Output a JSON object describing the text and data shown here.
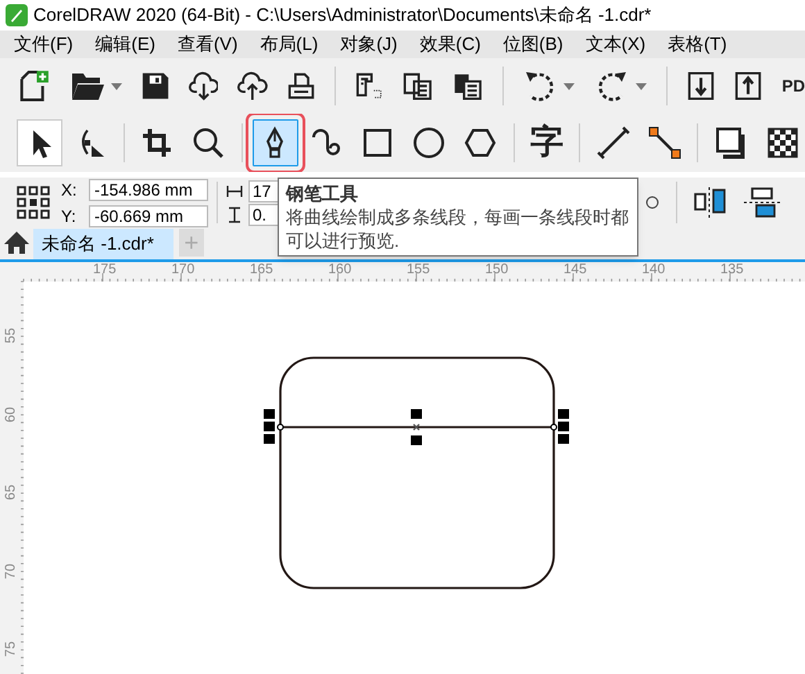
{
  "window": {
    "title": "CorelDRAW 2020 (64-Bit) - C:\\Users\\Administrator\\Documents\\未命名 -1.cdr*"
  },
  "menu": [
    "文件(F)",
    "编辑(E)",
    "查看(V)",
    "布局(L)",
    "对象(J)",
    "效果(C)",
    "位图(B)",
    "文本(X)",
    "表格(T)"
  ],
  "standard_toolbar": {
    "pdf_label": "PD"
  },
  "toolbox": [
    {
      "kind": "pick",
      "selected": false
    },
    {
      "kind": "shape",
      "selected": false
    },
    {
      "kind": "crop",
      "selected": false
    },
    {
      "kind": "zoom",
      "selected": false
    },
    {
      "kind": "pen",
      "selected": true
    },
    {
      "kind": "media",
      "selected": false
    },
    {
      "kind": "rect",
      "selected": false
    },
    {
      "kind": "ellipse",
      "selected": false
    },
    {
      "kind": "polygon",
      "selected": false
    },
    {
      "kind": "text",
      "label": "字",
      "selected": false
    },
    {
      "kind": "dimension",
      "selected": false
    },
    {
      "kind": "connector",
      "selected": false
    },
    {
      "kind": "shadow",
      "selected": false
    },
    {
      "kind": "transparency",
      "selected": false
    }
  ],
  "property_bar": {
    "x_label": "X:",
    "x_value": "-154.986 mm",
    "y_label": "Y:",
    "y_value": "-60.669 mm",
    "width_value": "17",
    "height_value": "0."
  },
  "tooltip": {
    "title": "钢笔工具",
    "text": "将曲线绘制成多条线段，每画一条线段时都可以进行预览."
  },
  "tabs": [
    {
      "label": "未命名 -1.cdr*",
      "selected": true
    }
  ],
  "new_tab": "+",
  "rulers": {
    "horizontal": [
      "175",
      "170",
      "165",
      "160",
      "155",
      "150",
      "145",
      "140",
      "135"
    ],
    "vertical": [
      "55",
      "60",
      "65",
      "70",
      "75"
    ]
  }
}
